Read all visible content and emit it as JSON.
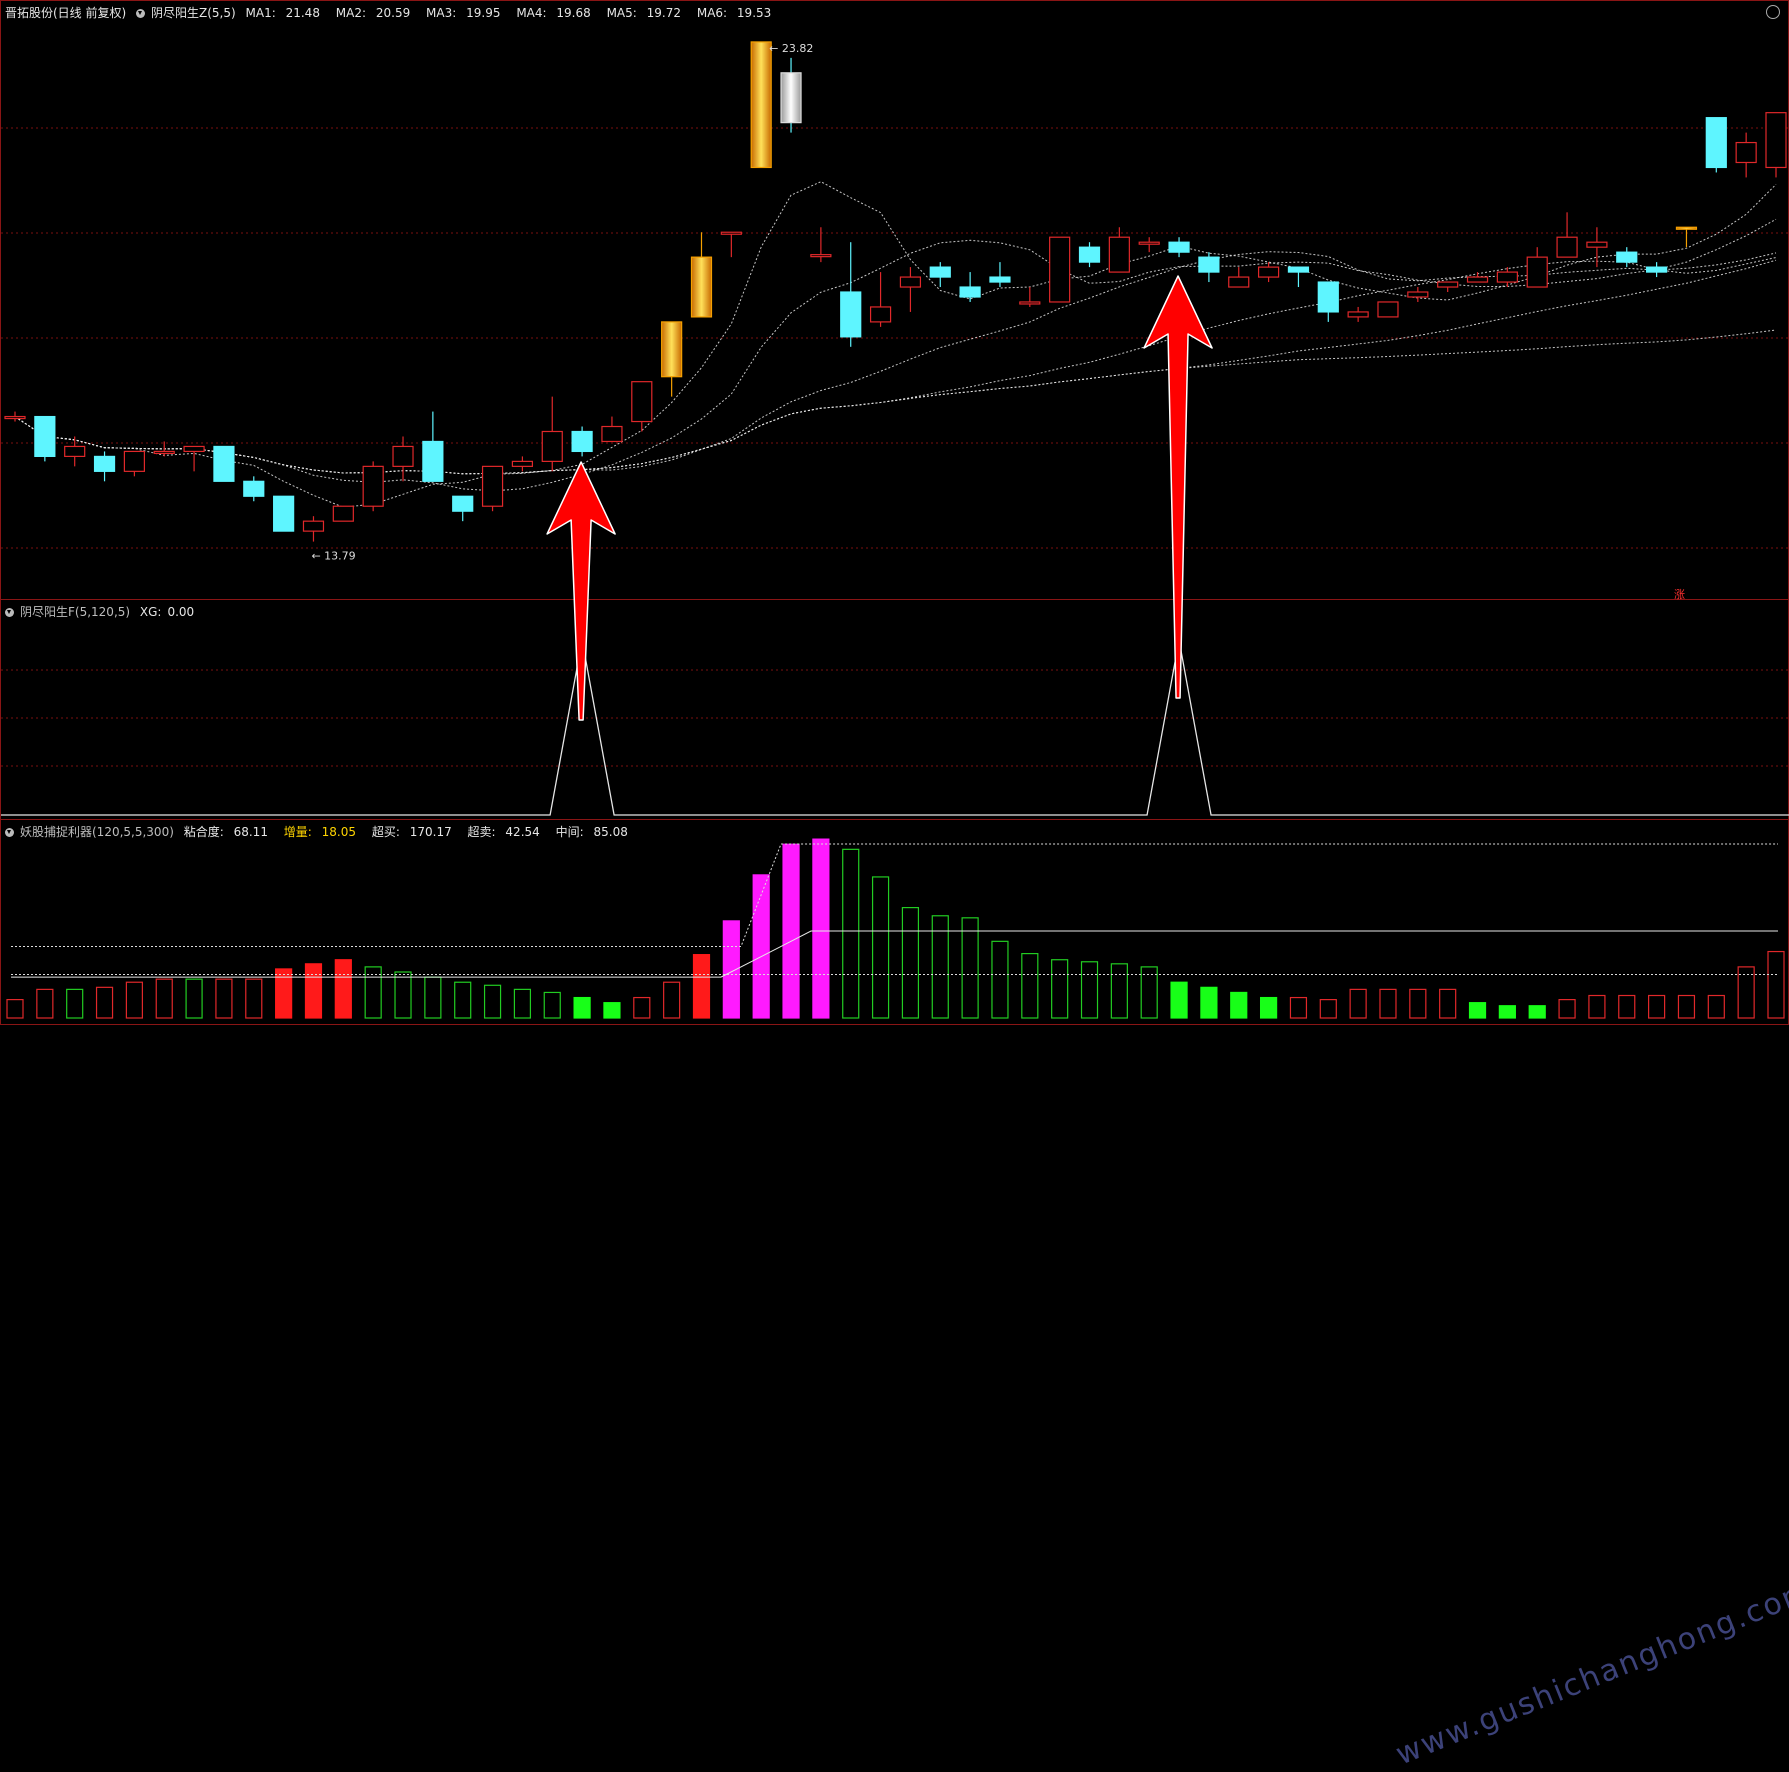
{
  "main_panel": {
    "stock_name": "晋拓股份(日线 前复权)",
    "indicator_name": "阴尽阳生Z(5,5)",
    "ma": [
      {
        "label": "MA1:",
        "value": "21.48"
      },
      {
        "label": "MA2:",
        "value": "20.59"
      },
      {
        "label": "MA3:",
        "value": "19.95"
      },
      {
        "label": "MA4:",
        "value": "19.68"
      },
      {
        "label": "MA5:",
        "value": "19.72"
      },
      {
        "label": "MA6:",
        "value": "19.53"
      }
    ],
    "high_label": "23.82",
    "low_label": "13.79",
    "flag": "涨"
  },
  "mid_panel": {
    "indicator_name": "阴尽阳生F(5,120,5)",
    "xg_label": "XG:",
    "xg_value": "0.00"
  },
  "bottom_panel": {
    "indicator_name": "妖股捕捉利器(120,5,5,300)",
    "fields": [
      {
        "label": "粘合度:",
        "value": "68.11",
        "color": "#e6e6e6"
      },
      {
        "label": "增量:",
        "value": "18.05",
        "color": "#ffd400"
      },
      {
        "label": "超买:",
        "value": "170.17",
        "color": "#e6e6e6"
      },
      {
        "label": "超卖:",
        "value": "42.54",
        "color": "#e6e6e6"
      },
      {
        "label": "中间:",
        "value": "85.08",
        "color": "#e6e6e6"
      }
    ]
  },
  "watermark": "www.gushichanghong.com",
  "colors": {
    "up": "#e0282a",
    "down": "#5ef5ff",
    "limit_up": "#f5a000",
    "grid": "#7a1010",
    "ma_line": "#e8e8e8",
    "bar_red": "#ff1a1a",
    "bar_green": "#18ff18",
    "bar_magenta": "#ff1aff",
    "bar_outline_green": "#22cc22",
    "arrow": "#ff0000"
  },
  "chart_data": {
    "type": "candlestick",
    "ohlc": [
      [
        16.3,
        16.3,
        16.2,
        16.4
      ],
      [
        16.3,
        15.5,
        15.4,
        16.3
      ],
      [
        15.5,
        15.7,
        15.3,
        15.9
      ],
      [
        15.5,
        15.2,
        15.0,
        15.6
      ],
      [
        15.2,
        15.6,
        15.1,
        15.6
      ],
      [
        15.6,
        15.6,
        15.5,
        15.8
      ],
      [
        15.6,
        15.7,
        15.2,
        15.7
      ],
      [
        15.7,
        15.0,
        15.0,
        15.7
      ],
      [
        15.0,
        14.7,
        14.6,
        15.1
      ],
      [
        14.7,
        14.0,
        14.0,
        14.7
      ],
      [
        14.0,
        14.2,
        13.79,
        14.3
      ],
      [
        14.2,
        14.5,
        14.2,
        14.5
      ],
      [
        14.5,
        15.3,
        14.4,
        15.4
      ],
      [
        15.3,
        15.7,
        15.0,
        15.9
      ],
      [
        15.8,
        15.0,
        15.0,
        16.4
      ],
      [
        14.7,
        14.4,
        14.2,
        14.7
      ],
      [
        14.5,
        15.3,
        14.4,
        15.3
      ],
      [
        15.3,
        15.4,
        15.2,
        15.5
      ],
      [
        15.4,
        16.0,
        15.2,
        16.7
      ],
      [
        16.0,
        15.6,
        15.5,
        16.1
      ],
      [
        15.8,
        16.1,
        15.8,
        16.3
      ],
      [
        16.2,
        17.0,
        16.0,
        17.0
      ],
      [
        17.1,
        18.2,
        16.7,
        18.2
      ],
      [
        18.3,
        19.5,
        18.3,
        20.0
      ],
      [
        20.0,
        20.0,
        19.5,
        20.0
      ],
      [
        21.3,
        23.82,
        21.3,
        23.82
      ],
      [
        23.2,
        22.2,
        22.0,
        23.5
      ],
      [
        19.55,
        19.55,
        19.4,
        20.1
      ],
      [
        18.8,
        17.9,
        17.7,
        19.8
      ],
      [
        18.2,
        18.5,
        18.1,
        19.2
      ],
      [
        18.9,
        19.1,
        18.4,
        19.3
      ],
      [
        19.3,
        19.1,
        18.9,
        19.4
      ],
      [
        18.9,
        18.7,
        18.6,
        19.2
      ],
      [
        19.1,
        19.0,
        18.9,
        19.4
      ],
      [
        18.6,
        18.6,
        18.5,
        18.9
      ],
      [
        18.6,
        19.9,
        18.6,
        19.9
      ],
      [
        19.7,
        19.4,
        19.3,
        19.8
      ],
      [
        19.2,
        19.9,
        19.2,
        20.1
      ],
      [
        19.8,
        19.8,
        19.6,
        19.9
      ],
      [
        19.8,
        19.6,
        19.5,
        19.9
      ],
      [
        19.5,
        19.2,
        19.0,
        19.6
      ],
      [
        18.9,
        19.1,
        18.9,
        19.3
      ],
      [
        19.1,
        19.3,
        19.0,
        19.4
      ],
      [
        19.3,
        19.2,
        18.9,
        19.3
      ],
      [
        19.0,
        18.4,
        18.2,
        19.0
      ],
      [
        18.3,
        18.4,
        18.2,
        18.5
      ],
      [
        18.3,
        18.6,
        18.3,
        18.6
      ],
      [
        18.7,
        18.8,
        18.6,
        18.9
      ],
      [
        18.9,
        19.0,
        18.8,
        19.0
      ],
      [
        19.0,
        19.1,
        19.0,
        19.2
      ],
      [
        19.0,
        19.2,
        18.9,
        19.3
      ],
      [
        18.9,
        19.5,
        18.9,
        19.7
      ],
      [
        19.5,
        19.9,
        19.5,
        20.4
      ],
      [
        19.7,
        19.8,
        19.3,
        20.1
      ],
      [
        19.6,
        19.4,
        19.3,
        19.7
      ],
      [
        19.3,
        19.2,
        19.1,
        19.4
      ],
      [
        20.1,
        20.1,
        19.7,
        20.1
      ],
      [
        22.3,
        21.3,
        21.2,
        22.3
      ],
      [
        21.4,
        21.8,
        21.1,
        22.0
      ],
      [
        21.3,
        22.4,
        21.1,
        22.4
      ]
    ],
    "limit_up_index": [
      22,
      23,
      25,
      56
    ],
    "xg_signal_index": [
      19,
      39
    ],
    "bottom_bars": [
      {
        "v": 18,
        "c": "o_red"
      },
      {
        "v": 28,
        "c": "o_red"
      },
      {
        "v": 28,
        "c": "o_green"
      },
      {
        "v": 30,
        "c": "o_red"
      },
      {
        "v": 35,
        "c": "o_red"
      },
      {
        "v": 38,
        "c": "o_red"
      },
      {
        "v": 38,
        "c": "o_green"
      },
      {
        "v": 38,
        "c": "o_red"
      },
      {
        "v": 38,
        "c": "o_red"
      },
      {
        "v": 48,
        "c": "red"
      },
      {
        "v": 53,
        "c": "red"
      },
      {
        "v": 57,
        "c": "red"
      },
      {
        "v": 50,
        "c": "o_green"
      },
      {
        "v": 45,
        "c": "o_green"
      },
      {
        "v": 40,
        "c": "o_green"
      },
      {
        "v": 35,
        "c": "o_green"
      },
      {
        "v": 32,
        "c": "o_green"
      },
      {
        "v": 28,
        "c": "o_green"
      },
      {
        "v": 25,
        "c": "o_green"
      },
      {
        "v": 20,
        "c": "green"
      },
      {
        "v": 15,
        "c": "green"
      },
      {
        "v": 20,
        "c": "o_red"
      },
      {
        "v": 35,
        "c": "o_red"
      },
      {
        "v": 62,
        "c": "red"
      },
      {
        "v": 95,
        "c": "magenta"
      },
      {
        "v": 140,
        "c": "magenta"
      },
      {
        "v": 170,
        "c": "magenta"
      },
      {
        "v": 175,
        "c": "magenta"
      },
      {
        "v": 165,
        "c": "o_green"
      },
      {
        "v": 138,
        "c": "o_green"
      },
      {
        "v": 108,
        "c": "o_green"
      },
      {
        "v": 100,
        "c": "o_green"
      },
      {
        "v": 98,
        "c": "o_green"
      },
      {
        "v": 75,
        "c": "o_green"
      },
      {
        "v": 63,
        "c": "o_green"
      },
      {
        "v": 57,
        "c": "o_green"
      },
      {
        "v": 55,
        "c": "o_green"
      },
      {
        "v": 53,
        "c": "o_green"
      },
      {
        "v": 50,
        "c": "o_green"
      },
      {
        "v": 35,
        "c": "green"
      },
      {
        "v": 30,
        "c": "green"
      },
      {
        "v": 25,
        "c": "green"
      },
      {
        "v": 20,
        "c": "green"
      },
      {
        "v": 20,
        "c": "o_red"
      },
      {
        "v": 18,
        "c": "o_red"
      },
      {
        "v": 28,
        "c": "o_red"
      },
      {
        "v": 28,
        "c": "o_red"
      },
      {
        "v": 28,
        "c": "o_red"
      },
      {
        "v": 28,
        "c": "o_red"
      },
      {
        "v": 15,
        "c": "green"
      },
      {
        "v": 12,
        "c": "green"
      },
      {
        "v": 12,
        "c": "green"
      },
      {
        "v": 18,
        "c": "o_red"
      },
      {
        "v": 22,
        "c": "o_red"
      },
      {
        "v": 22,
        "c": "o_red"
      },
      {
        "v": 22,
        "c": "o_red"
      },
      {
        "v": 22,
        "c": "o_red"
      },
      {
        "v": 22,
        "c": "o_red"
      },
      {
        "v": 50,
        "c": "o_red"
      },
      {
        "v": 65,
        "c": "o_red"
      }
    ],
    "bottom_ylim": [
      0,
      180
    ],
    "overbought": 170.17,
    "oversold": 42.54,
    "middle": 85.08,
    "ylim": [
      13.3,
      24.2
    ]
  }
}
